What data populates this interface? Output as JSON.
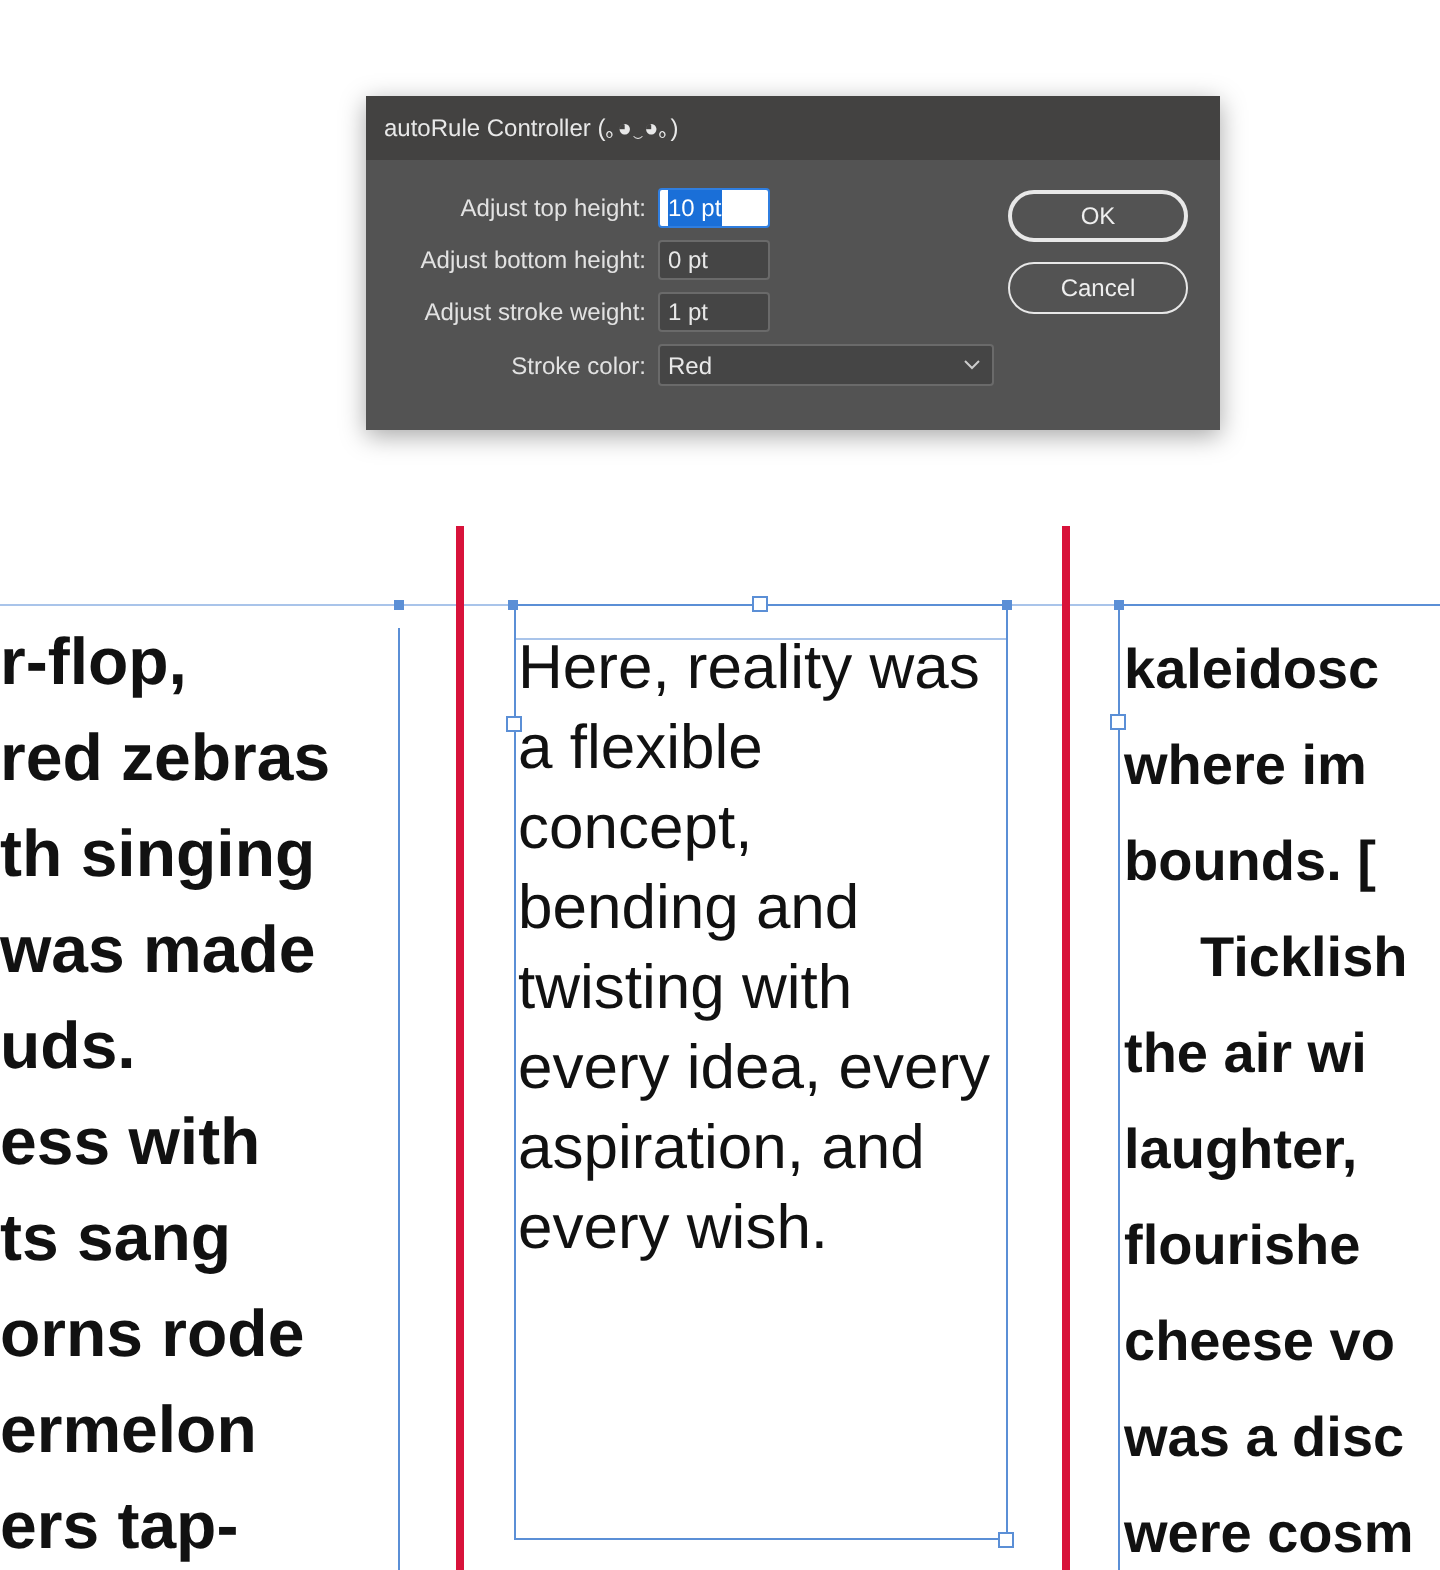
{
  "dialog": {
    "title": "autoRule Controller (｡◕‿◕｡)",
    "fields": [
      {
        "label": "Adjust top height:",
        "value": "10 pt",
        "selected": true
      },
      {
        "label": "Adjust bottom height:",
        "value": "0 pt",
        "selected": false
      },
      {
        "label": "Adjust stroke weight:",
        "value": "1 pt",
        "selected": false
      }
    ],
    "stroke_color": {
      "label": "Stroke color:",
      "value": "Red"
    },
    "buttons": [
      "OK",
      "Cancel"
    ]
  },
  "document": {
    "columns": [
      {
        "kind": "left",
        "lines": [
          "r-flop,",
          "red zebras",
          "th singing",
          "was made",
          "uds.",
          "ess with",
          "ts sang",
          "orns rode",
          "ermelon",
          "ers tap-"
        ]
      },
      {
        "kind": "frame",
        "lines": [
          "Here, reality was",
          "a flexible",
          "concept,",
          "bending and",
          "twisting with",
          "every idea, every",
          "aspiration, and",
          "every wish."
        ]
      },
      {
        "kind": "right",
        "paragraphs": [
          {
            "lines": [
              "kaleidosc",
              "where im",
              "bounds. ["
            ]
          },
          {
            "lines": [
              "Ticklish",
              "the air wi",
              "laughter,",
              "flourishe",
              "cheese vo",
              "was a disc",
              "were cosm"
            ]
          }
        ]
      }
    ]
  }
}
